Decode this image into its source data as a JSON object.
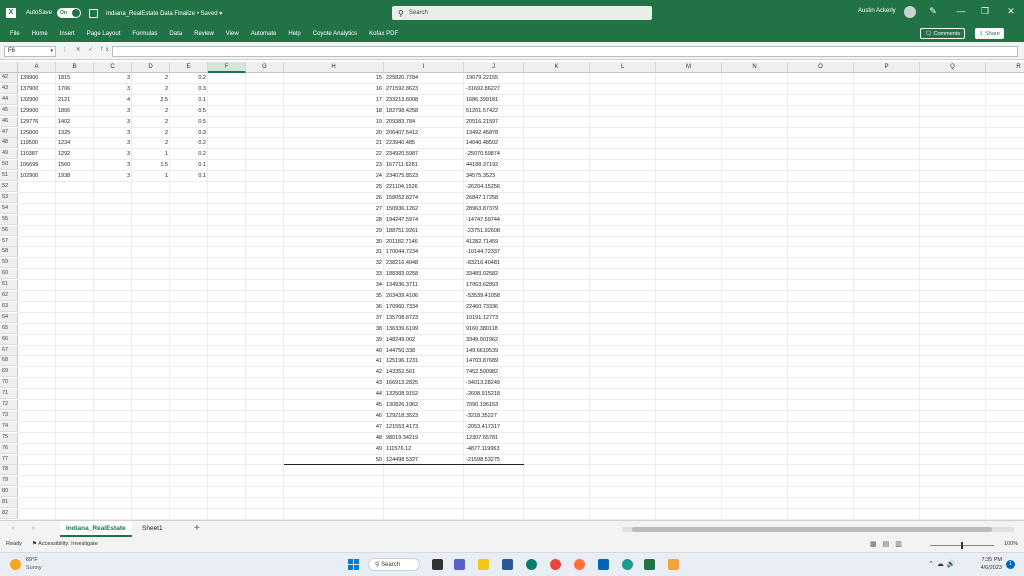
{
  "titlebar": {
    "autosave_label": "AutoSave",
    "autosave_state": "On",
    "document_title": "Indiana_RealEstate Data Finalize • Saved ▾",
    "search_placeholder": "Search",
    "user_name": "Austin Ackerly",
    "minimize": "—",
    "restore": "❐",
    "close": "✕",
    "pen": "✎"
  },
  "ribbon": {
    "tabs": [
      "File",
      "Home",
      "Insert",
      "Page Layout",
      "Formulas",
      "Data",
      "Review",
      "View",
      "Automate",
      "Help",
      "Coyote Analytics",
      "Kofax PDF"
    ],
    "comments_label": "Comments",
    "share_label": "Share"
  },
  "formula_bar": {
    "name_box": "F6",
    "fx_icons": "⋮ ✕ ✓ fx",
    "formula": ""
  },
  "grid": {
    "columns": [
      "A",
      "B",
      "C",
      "D",
      "E",
      "F",
      "G",
      "H",
      "I",
      "J",
      "K",
      "L",
      "M",
      "N",
      "O",
      "P",
      "Q",
      "R",
      "S",
      "T",
      "U"
    ],
    "selected_column": "F",
    "row_numbers": [
      "42",
      "43",
      "44",
      "45",
      "46",
      "47",
      "48",
      "49",
      "50",
      "51",
      "52",
      "53",
      "54",
      "55",
      "56",
      "57",
      "58",
      "59",
      "60",
      "61",
      "62",
      "63",
      "64",
      "65",
      "66",
      "67",
      "68",
      "69",
      "70",
      "71",
      "72",
      "73",
      "74",
      "75",
      "76",
      "77",
      "78",
      "79",
      "80",
      "81",
      "82"
    ],
    "left_rows": [
      [
        "139900",
        "1815",
        "3",
        "2",
        "0.2"
      ],
      [
        "137900",
        "1706",
        "3",
        "2",
        "0.3"
      ],
      [
        "132900",
        "2121",
        "4",
        "2.5",
        "0.1"
      ],
      [
        "129900",
        "1806",
        "3",
        "2",
        "0.5"
      ],
      [
        "129776",
        "1402",
        "3",
        "2",
        "0.5"
      ],
      [
        "125000",
        "1325",
        "3",
        "2",
        "0.3"
      ],
      [
        "119500",
        "1234",
        "3",
        "2",
        "0.2"
      ],
      [
        "110387",
        "1292",
        "3",
        "1",
        "0.2"
      ],
      [
        "106699",
        "1560",
        "3",
        "1.5",
        "0.1"
      ],
      [
        "102900",
        "1938",
        "3",
        "1",
        "0.1"
      ]
    ],
    "right_rows": [
      [
        "15",
        "225820.7784",
        "19079.22155"
      ],
      [
        "16",
        "271592.8623",
        "-31692.86227"
      ],
      [
        "17",
        "233213.6008",
        "1686.399181"
      ],
      [
        "18",
        "182798.4258",
        "51201.57422"
      ],
      [
        "19",
        "209383.784",
        "20516.21597"
      ],
      [
        "20",
        "206407.5412",
        "13492.45878"
      ],
      [
        "21",
        "223940.485",
        "14040.48502"
      ],
      [
        "22",
        "234920.5987",
        "-25070.59874"
      ],
      [
        "23",
        "167711.6281",
        "44188.37192"
      ],
      [
        "24",
        "234075.8523",
        "34575.3523"
      ],
      [
        "25",
        "221104.1526",
        "-26204.15256"
      ],
      [
        "26",
        "158052.8274",
        "26847.17258"
      ],
      [
        "27",
        "150936.1262",
        "28963.87379"
      ],
      [
        "28",
        "194247.5974",
        "-14747.59744"
      ],
      [
        "29",
        "188751.9261",
        "-23751.92608"
      ],
      [
        "30",
        "201182.7146",
        "41282.71459"
      ],
      [
        "31",
        "170044.7234",
        "-10144.72337"
      ],
      [
        "32",
        "238216.4048",
        "-83216.40481"
      ],
      [
        "33",
        "188383.0258",
        "33483.02582"
      ],
      [
        "34",
        "134936.3711",
        "17063.62893"
      ],
      [
        "35",
        "203439.4106",
        "-53539.41058"
      ],
      [
        "36",
        "170960.7334",
        "22460.73336"
      ],
      [
        "37",
        "135708.8723",
        "10191.12773"
      ],
      [
        "38",
        "136339.6199",
        "9160.380118"
      ],
      [
        "39",
        "148249.002",
        "3349.001962"
      ],
      [
        "40",
        "144750.338",
        "149.6619539"
      ],
      [
        "41",
        "125196.1231",
        "14703.87689"
      ],
      [
        "42",
        "143352.561",
        "7452.500982"
      ],
      [
        "43",
        "166913.2825",
        "-34013.28249"
      ],
      [
        "44",
        "132508.9152",
        "-2608.915218"
      ],
      [
        "45",
        "130826.1962",
        "7090.196153"
      ],
      [
        "46",
        "129218.3523",
        "-3218.35227"
      ],
      [
        "47",
        "121553.4173",
        "-2053.417317"
      ],
      [
        "48",
        "98019.34219",
        "12307.65781"
      ],
      [
        "49",
        "111576.12",
        "-4877.119963"
      ],
      [
        "50",
        "124498.5327",
        "-21598.53275"
      ]
    ]
  },
  "sheets": {
    "tabs": [
      "Indiana_RealEstate",
      "Sheet1"
    ],
    "active": "Indiana_RealEstate",
    "add": "+"
  },
  "statusbar": {
    "ready": "Ready",
    "accessibility": "Accessibility: Investigate",
    "zoom": "100%"
  },
  "taskbar": {
    "temp": "69°F",
    "condition": "Sunny",
    "search": "Search",
    "time": "7:35 PM",
    "date": "4/6/2023",
    "notifications": "1"
  },
  "colors": {
    "excel_green": "#217346",
    "selected_header_bg": "#d3e6d9"
  }
}
